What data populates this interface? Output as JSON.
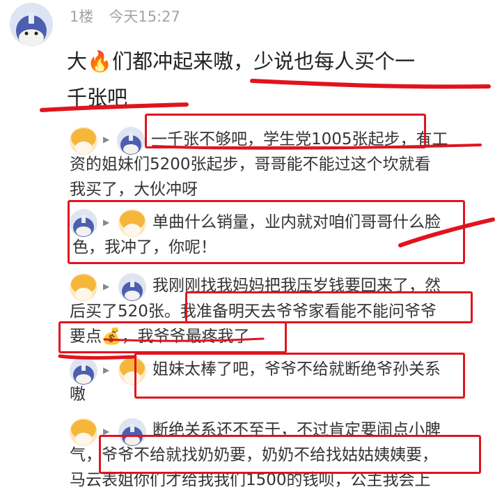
{
  "post": {
    "floor": "1楼",
    "time": "今天15:27",
    "line1_a": "大",
    "line1_b": "们都冲起来嗷，少说也每人买个一",
    "line2": "千张吧"
  },
  "replies": [
    {
      "l1": "一千张不够吧，学生党1005张起步，有工",
      "l2": "资的姐妹们5200张起步，哥哥能不能过这个坎就看",
      "l3": "我买了，大伙冲呀"
    },
    {
      "l1": "单曲什么销量，业内就对咱们哥哥什么脸",
      "l2": "色，我冲了，你呢！"
    },
    {
      "l1": "我刚刚找我妈妈把我压岁钱要回来了，然",
      "l2": "后买了520张。我准备明天去爷爷家看能不能问爷爷",
      "l3a": "要点",
      "l3b": "，我爷爷最疼我了"
    },
    {
      "l1": "姐妹太棒了吧，爷爷不给就断绝爷孙关系",
      "l2": "嗷"
    },
    {
      "l1": "断绝关系还不至于，不过肯定要闹点小脾",
      "l2": "气，爷爷不给就找奶奶要，奶奶不给找姑姑姨姨要，",
      "l3": "马云表姐你们才给我我们1500的钱呗，公主我会上"
    }
  ],
  "colors": {
    "annotation_red": "#e0141e",
    "meta_gray": "#a4a4a4"
  },
  "icons": {
    "fire": "fire-emoji",
    "money": "money-bag-emoji"
  }
}
